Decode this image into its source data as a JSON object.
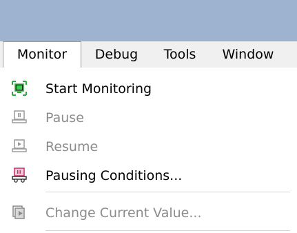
{
  "menubar": {
    "items": [
      {
        "label": "Monitor"
      },
      {
        "label": "Debug"
      },
      {
        "label": "Tools"
      },
      {
        "label": "Window"
      }
    ]
  },
  "dropdown": {
    "items": [
      {
        "label": "Start Monitoring",
        "enabled": true,
        "icon": "start-monitoring-icon"
      },
      {
        "label": "Pause",
        "enabled": false,
        "icon": "pause-icon"
      },
      {
        "label": "Resume",
        "enabled": false,
        "icon": "resume-icon"
      },
      {
        "label": "Pausing Conditions...",
        "enabled": true,
        "icon": "pausing-conditions-icon"
      },
      {
        "label": "Change Current Value...",
        "enabled": false,
        "icon": "change-current-value-icon"
      }
    ]
  },
  "colors": {
    "titlebar": "#9db3d0",
    "menubar": "#f0f0f0",
    "disabled_text": "#8c8c8c",
    "accent_green": "#2eaa3c",
    "pause_conditions_red": "#cc2e6a"
  }
}
